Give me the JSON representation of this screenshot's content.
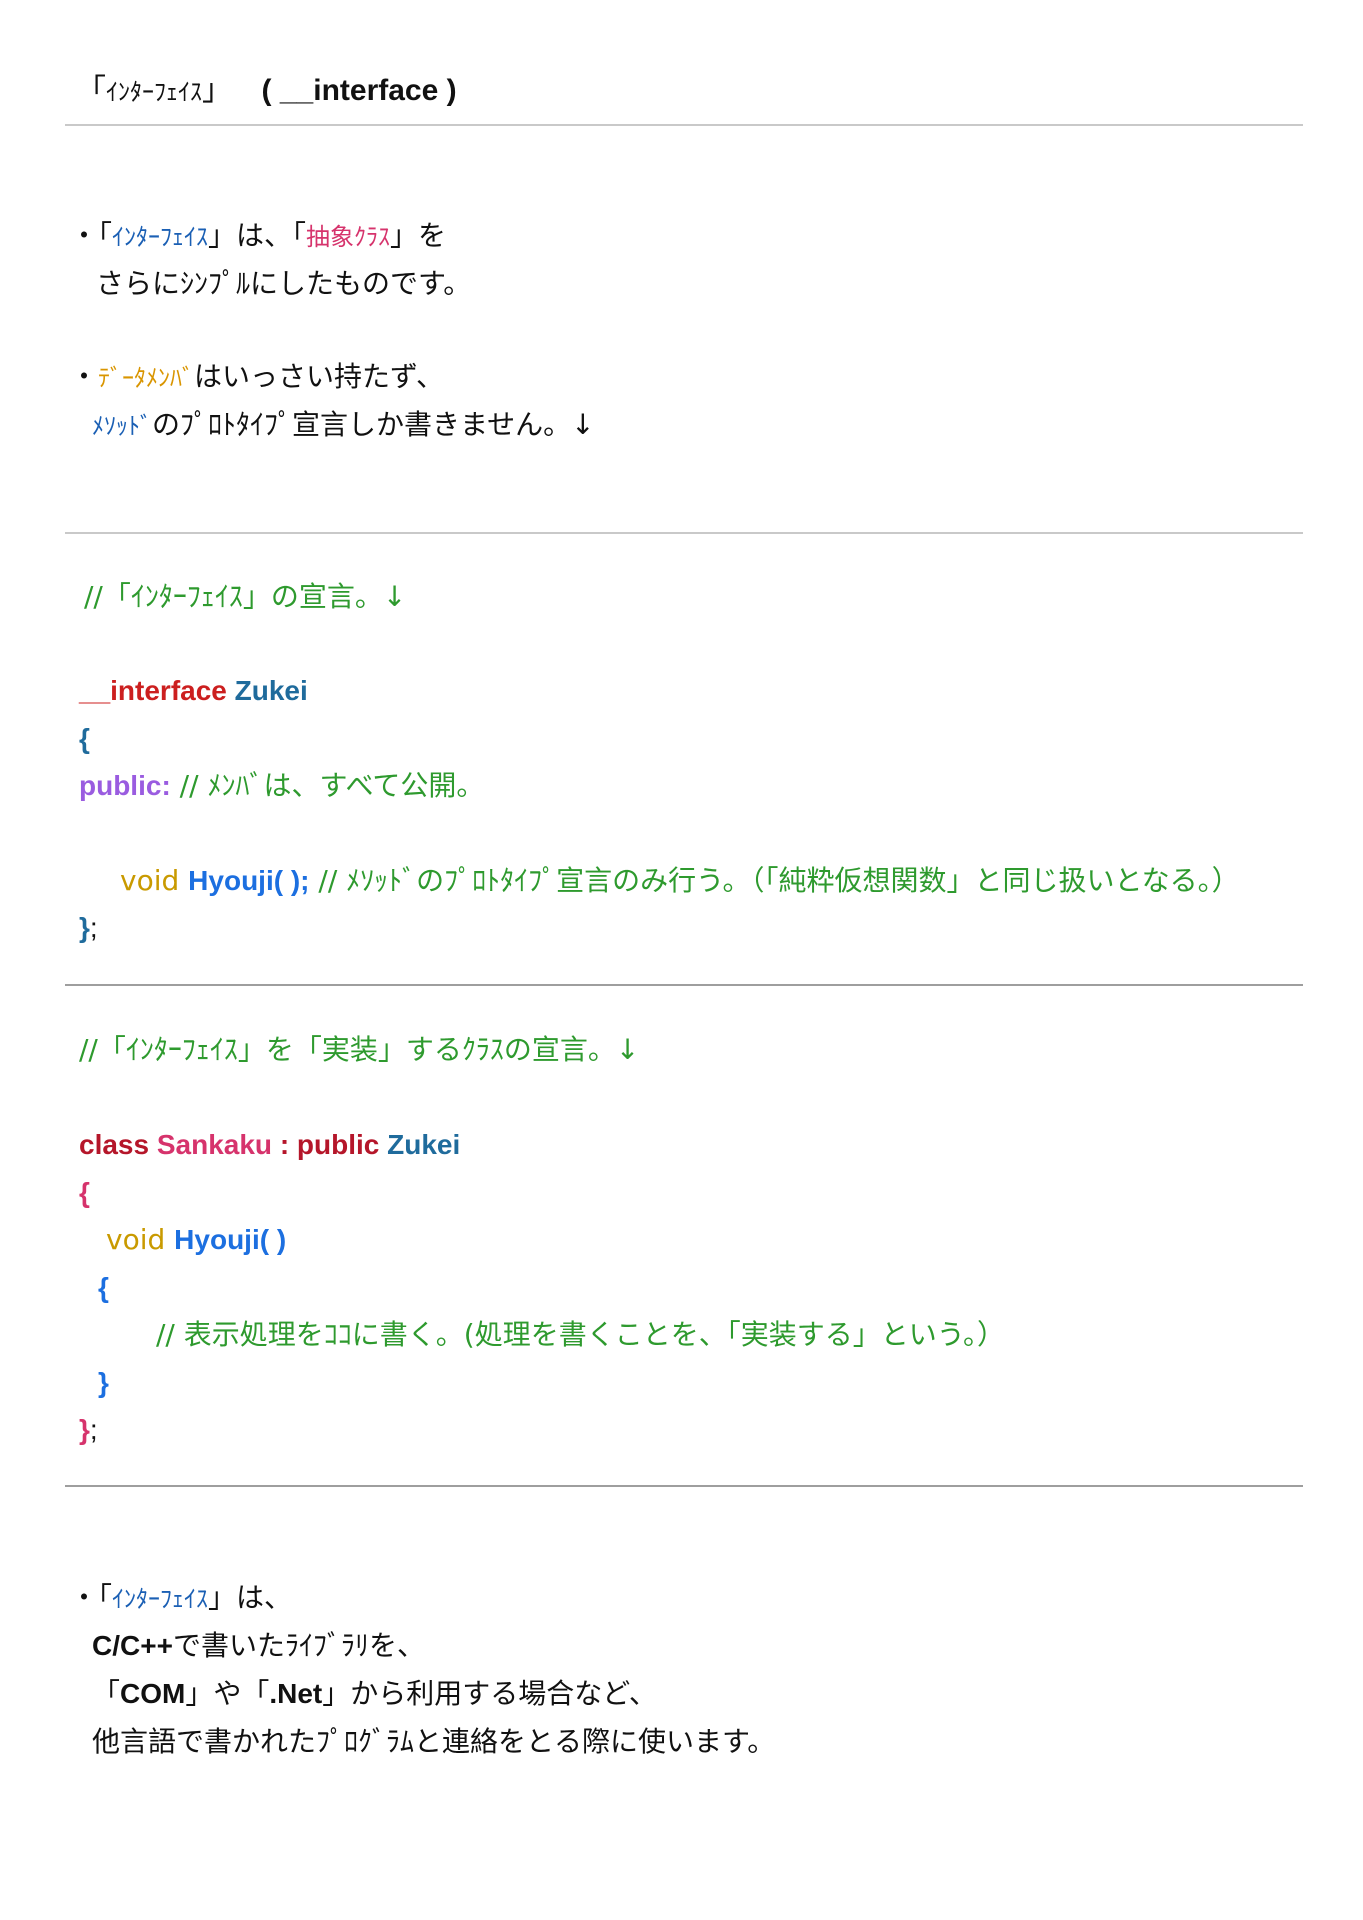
{
  "title": {
    "jp_open": "「",
    "jp": "ｲﾝﾀｰﾌｪｲｽ",
    "jp_close": "」",
    "en": "( __interface )"
  },
  "intro": {
    "p1_bullet": "・「",
    "p1_term": "ｲﾝﾀｰﾌｪｲｽ",
    "p1_mid": "」は、「",
    "p1_term2": "抽象ｸﾗｽ",
    "p1_end": "」を",
    "p1_line2": "さらにｼﾝﾌﾟﾙにしたものです。",
    "p2_bullet": "・",
    "p2_term": "ﾃﾞｰﾀﾒﾝﾊﾞ",
    "p2_rest": "はいっさい持たず、",
    "p2_term2": "ﾒｿｯﾄﾞ",
    "p2_line2": "のﾌﾟﾛﾄﾀｲﾌﾟ宣言しか書きません。↓"
  },
  "code1": {
    "comment": "//「ｲﾝﾀｰﾌｪｲｽ」の宣言。↓",
    "keyword": "__interface",
    "name": "Zukei",
    "open_brace": "{",
    "access": "public:",
    "access_comment": "// ﾒﾝﾊﾞは、すべて公開。",
    "ret_type": "void",
    "method": "Hyouji( );",
    "method_comment": "// ﾒｿｯﾄﾞのﾌﾟﾛﾄﾀｲﾌﾟ宣言のみ行う。（「純粋仮想関数」と同じ扱いとなる。）",
    "close_brace": "}",
    "semicolon": ";"
  },
  "code2": {
    "comment": "//「ｲﾝﾀｰﾌｪｲｽ」を「実装」するｸﾗｽの宣言。↓",
    "keyword": "class",
    "name": "Sankaku",
    "inherit": ": public",
    "base": "Zukei",
    "open_brace": "{",
    "ret_type": "void",
    "method": "Hyouji( )",
    "inner_open": "{",
    "body_comment": "// 表示処理をｺｺに書く。(処理を書くことを、「実装する」という。）",
    "inner_close": "}",
    "close_brace": "}",
    "semicolon": ";"
  },
  "outro": {
    "bullet": "・「",
    "term": "ｲﾝﾀｰﾌｪｲｽ",
    "l1_end": "」は、",
    "l2_bold": "C/C++",
    "l2_rest": "で書いたﾗｲﾌﾞﾗﾘを、",
    "l3_open": "「",
    "l3_com": "COM",
    "l3_mid": "」や「",
    "l3_net": ".Net",
    "l3_rest": "」から利用する場合など、",
    "l4": "他言語で書かれたﾌﾟﾛｸﾞﾗﾑと連絡をとる際に使います。"
  }
}
